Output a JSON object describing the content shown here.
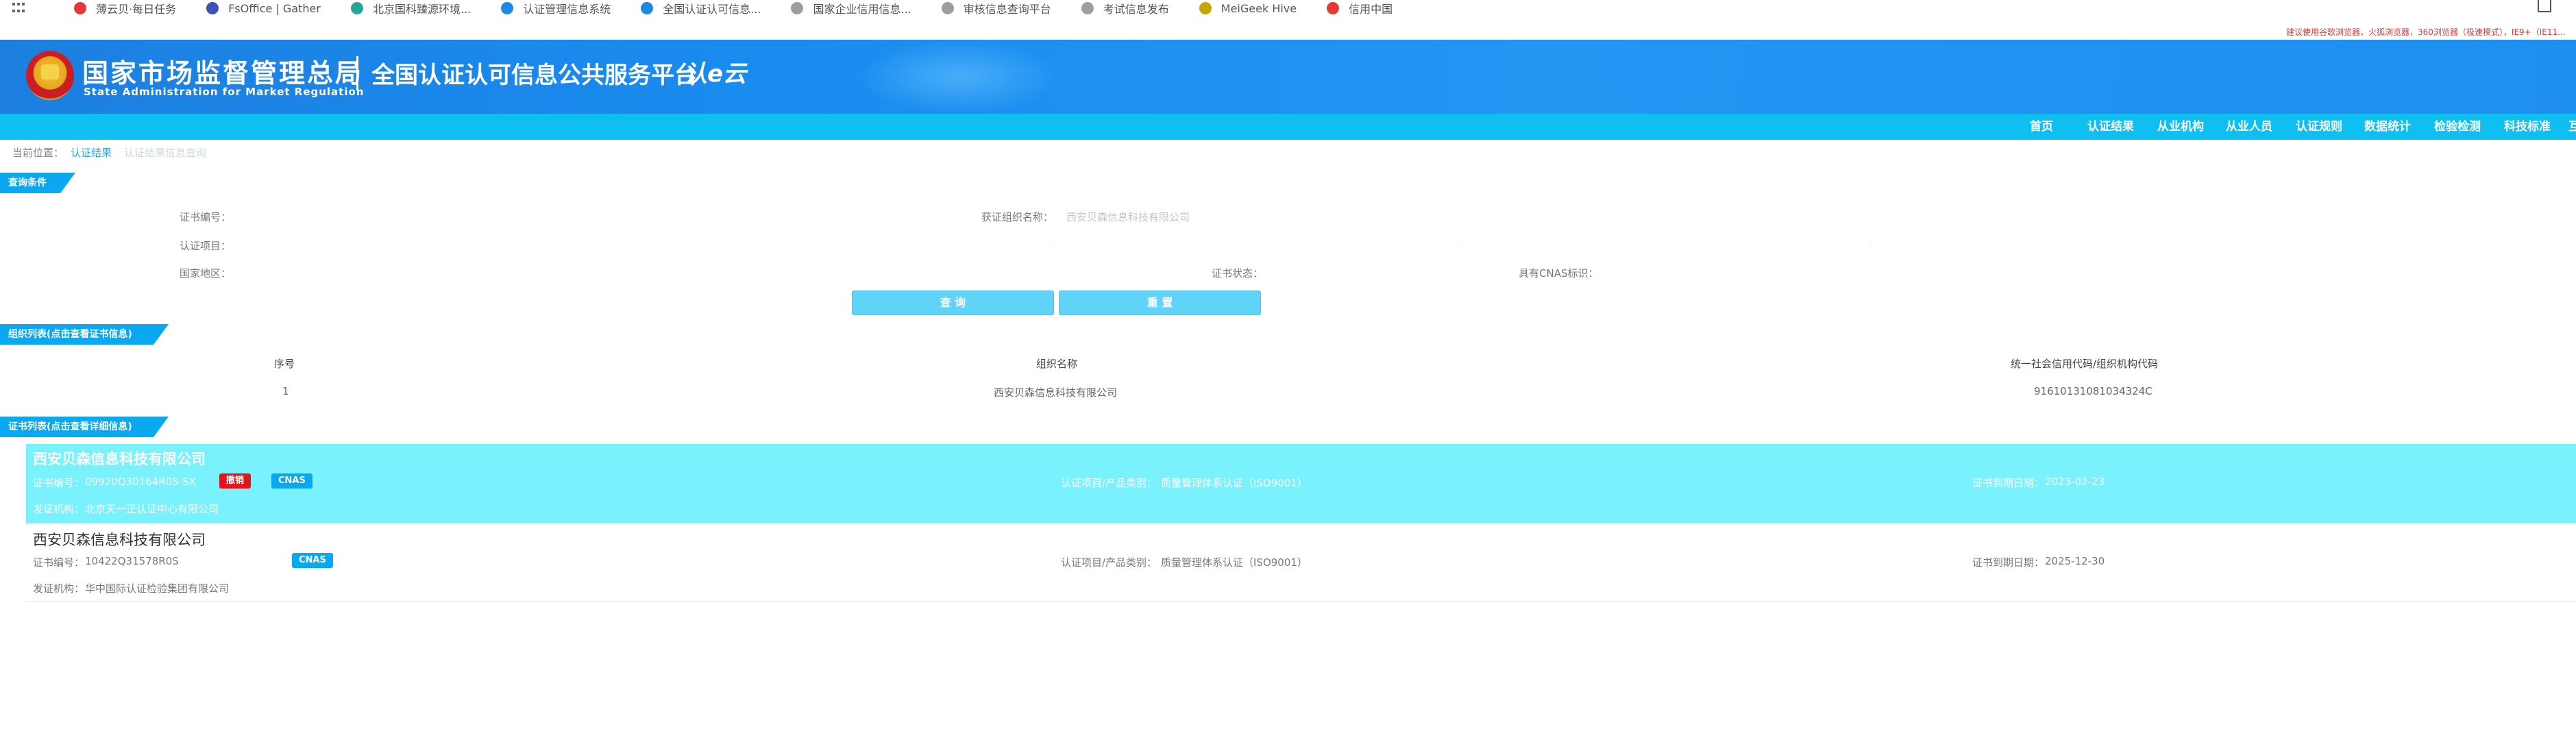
{
  "bookmarks": [
    {
      "label": "薄云贝·每日任务",
      "icon": "shield-icon",
      "color": "#e53935"
    },
    {
      "label": "FsOffice | Gather",
      "icon": "gear-icon",
      "color": "#3f51b5"
    },
    {
      "label": "北京国科臻源环境...",
      "icon": "leaf-icon",
      "color": "#26a69a"
    },
    {
      "label": "认证管理信息系统",
      "icon": "document-icon",
      "color": "#1e88e5"
    },
    {
      "label": "全国认证认可信息...",
      "icon": "document-icon",
      "color": "#1e88e5"
    },
    {
      "label": "国家企业信用信息...",
      "icon": "globe-icon",
      "color": "#9e9e9e"
    },
    {
      "label": "审核信息查询平台",
      "icon": "globe-icon",
      "color": "#9e9e9e"
    },
    {
      "label": "考试信息发布",
      "icon": "globe-icon",
      "color": "#9e9e9e"
    },
    {
      "label": "MeiGeek Hive",
      "icon": "hive-icon",
      "color": "#c6a700"
    },
    {
      "label": "信用中国",
      "icon": "emblem-icon",
      "color": "#e53935"
    }
  ],
  "header": {
    "title": "国家市场监督管理总局",
    "subtitle": "State Administration  for  Market Regulation",
    "platform": "全国认证认可信息公共服务平台",
    "logo_text": "认e云",
    "notice": "建议使用谷歌浏览器，火狐浏览器，360浏览器（极速模式），IE9+（IE11..."
  },
  "nav": [
    "首页",
    "认证结果",
    "从业机构",
    "从业人员",
    "认证规则",
    "数据统计",
    "检验检测",
    "科技标准",
    "互"
  ],
  "breadcrumb": {
    "prefix": "当前位置：",
    "current": "认证结果",
    "sub": "认证结果信息查询"
  },
  "query": {
    "section": "查询条件",
    "cert_no_label": "证书编号：",
    "org_label": "获证组织名称：",
    "org_value": "西安贝森信息科技有限公司",
    "item_label": "认证项目：",
    "region_label": "国家地区：",
    "status_label": "证书状态：",
    "cnas_label": "具有CNAS标识：",
    "search_btn": "查 询",
    "reset_btn": "重 置"
  },
  "org_list": {
    "section": "组织列表(点击查看证书信息)",
    "headers": [
      "序号",
      "组织名称",
      "统一社会信用代码/组织机构代码"
    ],
    "rows": [
      [
        "1",
        "西安贝森信息科技有限公司",
        "91610131081034324C"
      ]
    ]
  },
  "cert_list": {
    "section": "证书列表(点击查看详细信息)",
    "items": [
      {
        "name": "西安贝森信息科技有限公司",
        "cert_no_label": "证书编号：",
        "cert_no": "09920Q30164R0S-SX",
        "status_badge": "撤销",
        "cnas_badge": "CNAS",
        "project_label": "认证项目/产品类别：",
        "project": "质量管理体系认证（ISO9001）",
        "expiry_label": "证书到期日期：",
        "expiry": "2023-02-23",
        "issuer_label": "发证机构：",
        "issuer": "北京天一正认证中心有限公司"
      },
      {
        "name": "西安贝森信息科技有限公司",
        "cert_no_label": "证书编号：",
        "cert_no": "10422Q31578R0S",
        "cnas_badge": "CNAS",
        "project_label": "认证项目/产品类别：",
        "project": "质量管理体系认证（ISO9001）",
        "expiry_label": "证书到期日期：",
        "expiry": "2025-12-30",
        "issuer_label": "发证机构：",
        "issuer": "华中国际认证检验集团有限公司"
      }
    ]
  }
}
